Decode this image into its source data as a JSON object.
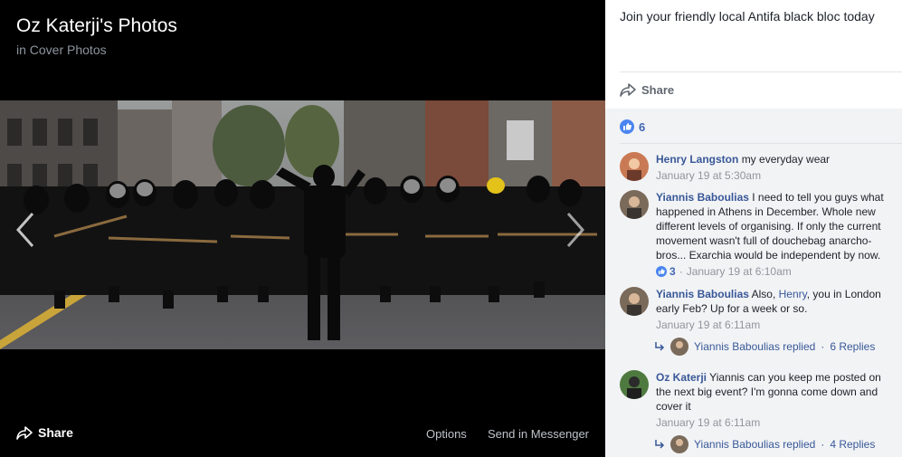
{
  "viewer": {
    "title": "Oz Katerji's Photos",
    "subtitle": "in Cover Photos",
    "share_label": "Share",
    "options_label": "Options",
    "messenger_label": "Send in Messenger"
  },
  "panel": {
    "caption": "Join your friendly local Antifa black bloc today",
    "share_label": "Share",
    "reaction_count": "6"
  },
  "comments": [
    {
      "author": "Henry Langston",
      "text": "my everyday wear",
      "time": "January 19 at 5:30am"
    },
    {
      "author": "Yiannis Baboulias",
      "text": "I need to tell you guys what happened in Athens in December. Whole new different levels of organising. If only the current movement wasn't full of douchebag anarcho-bros... Exarchia would be independent by now.",
      "likes": "3",
      "separator": "·",
      "time": "January 19 at 6:10am"
    },
    {
      "author": "Yiannis Baboulias",
      "text_before": "Also,",
      "mention": "Henry",
      "text_after": ", you in London early Feb? Up for a week or so.",
      "time": "January 19 at 6:11am",
      "reply_summary": "Yiannis Baboulias replied",
      "reply_sep": "·",
      "reply_count": "6 Replies"
    },
    {
      "author": "Oz Katerji",
      "text": "Yiannis can you keep me posted on the next big event? I'm gonna come down and cover it",
      "time": "January 19 at 6:11am",
      "reply_summary": "Yiannis Baboulias replied",
      "reply_sep": "·",
      "reply_count": "4 Replies"
    }
  ],
  "icons": {
    "share": "share-arrow-icon",
    "like": "thumbs-up-icon",
    "reply": "reply-arrow-icon",
    "prev": "chevron-left-icon",
    "next": "chevron-right-icon"
  },
  "colors": {
    "link": "#385898",
    "like_blue": "#4267b2",
    "muted": "#90949c"
  }
}
